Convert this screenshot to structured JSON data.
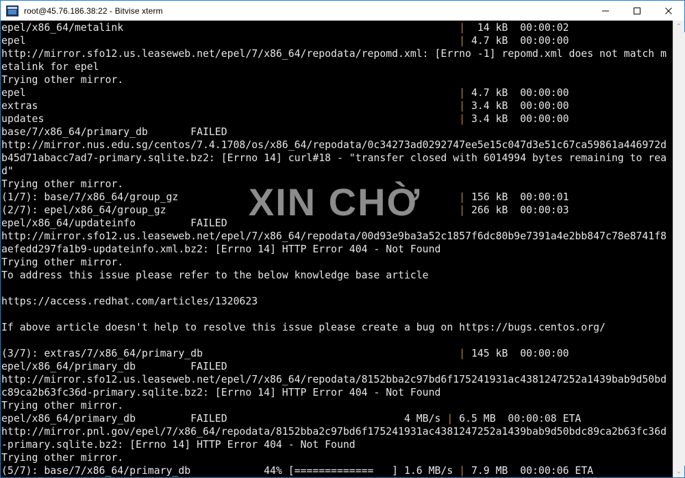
{
  "window": {
    "title": "root@45.76.186.38:22 - Bitvise xterm",
    "icon": "terminal-icon",
    "minimize_label": "—",
    "maximize_label": "□",
    "close_label": "✕"
  },
  "watermark": {
    "text": "XIN CHỜ",
    "color": "#8c8c8c"
  },
  "scrollbar": {
    "up_arrow": "⌃",
    "down_arrow": "⌄"
  },
  "colors": {
    "background": "#000000",
    "foreground": "#e6e6e6",
    "pipe": "#b9822f",
    "titlebar_border": "#1a7fd4"
  },
  "terminal": {
    "lines": [
      "epel/x86_64/metalink                                                       |  14 kB  00:00:02",
      "epel                                                                       | 4.7 kB  00:00:00",
      "http://mirror.sfo12.us.leaseweb.net/epel/7/x86_64/repodata/repomd.xml: [Errno -1] repomd.xml does not match m",
      "etalink for epel",
      "Trying other mirror.",
      "epel                                                                       | 4.7 kB  00:00:00",
      "extras                                                                     | 3.4 kB  00:00:00",
      "updates                                                                    | 3.4 kB  00:00:00",
      "base/7/x86_64/primary_db       FAILED",
      "http://mirror.nus.edu.sg/centos/7.4.1708/os/x86_64/repodata/0c34273ad0292747ee5e15c047d3e51c67ca59861a446972d",
      "b45d71abacc7ad7-primary.sqlite.bz2: [Errno 14] curl#18 - \"transfer closed with 6014994 bytes remaining to rea",
      "d\"",
      "Trying other mirror.",
      "(1/7): base/7/x86_64/group_gz                                              | 156 kB  00:00:01",
      "(2/7): epel/x86_64/group_gz                                                | 266 kB  00:00:03",
      "epel/x86_64/updateinfo         FAILED",
      "http://mirror.sfo12.us.leaseweb.net/epel/7/x86_64/repodata/00d93e9ba3a52c1857f6dc80b9e7391a4e2bb847c78e8741f8",
      "aefedd297fa1b9-updateinfo.xml.bz2: [Errno 14] HTTP Error 404 - Not Found",
      "Trying other mirror.",
      "To address this issue please refer to the below knowledge base article",
      "",
      "https://access.redhat.com/articles/1320623",
      "",
      "If above article doesn't help to resolve this issue please create a bug on https://bugs.centos.org/",
      "",
      "(3/7): extras/7/x86_64/primary_db                                          | 145 kB  00:00:00",
      "epel/x86_64/primary_db         FAILED",
      "http://mirror.sfo12.us.leaseweb.net/epel/7/x86_64/repodata/8152bba2c97bd6f175241931ac4381247252a1439bab9d50bd",
      "c89ca2b63fc36d-primary.sqlite.bz2: [Errno 14] HTTP Error 404 - Not Found",
      "Trying other mirror.",
      "epel/x86_64/primary_db         FAILED                             4 MB/s | 6.5 MB  00:00:08 ETA",
      "http://mirror.pnl.gov/epel/7/x86_64/repodata/8152bba2c97bd6f175241931ac4381247252a1439bab9d50bdc89ca2b63fc36d",
      "-primary.sqlite.bz2: [Errno 14] HTTP Error 404 - Not Found",
      "Trying other mirror.",
      "(5/7): base/7/x86_64/primary_db            44% [=============   ] 1.6 MB/s | 7.9 MB  00:00:06 ETA"
    ]
  }
}
